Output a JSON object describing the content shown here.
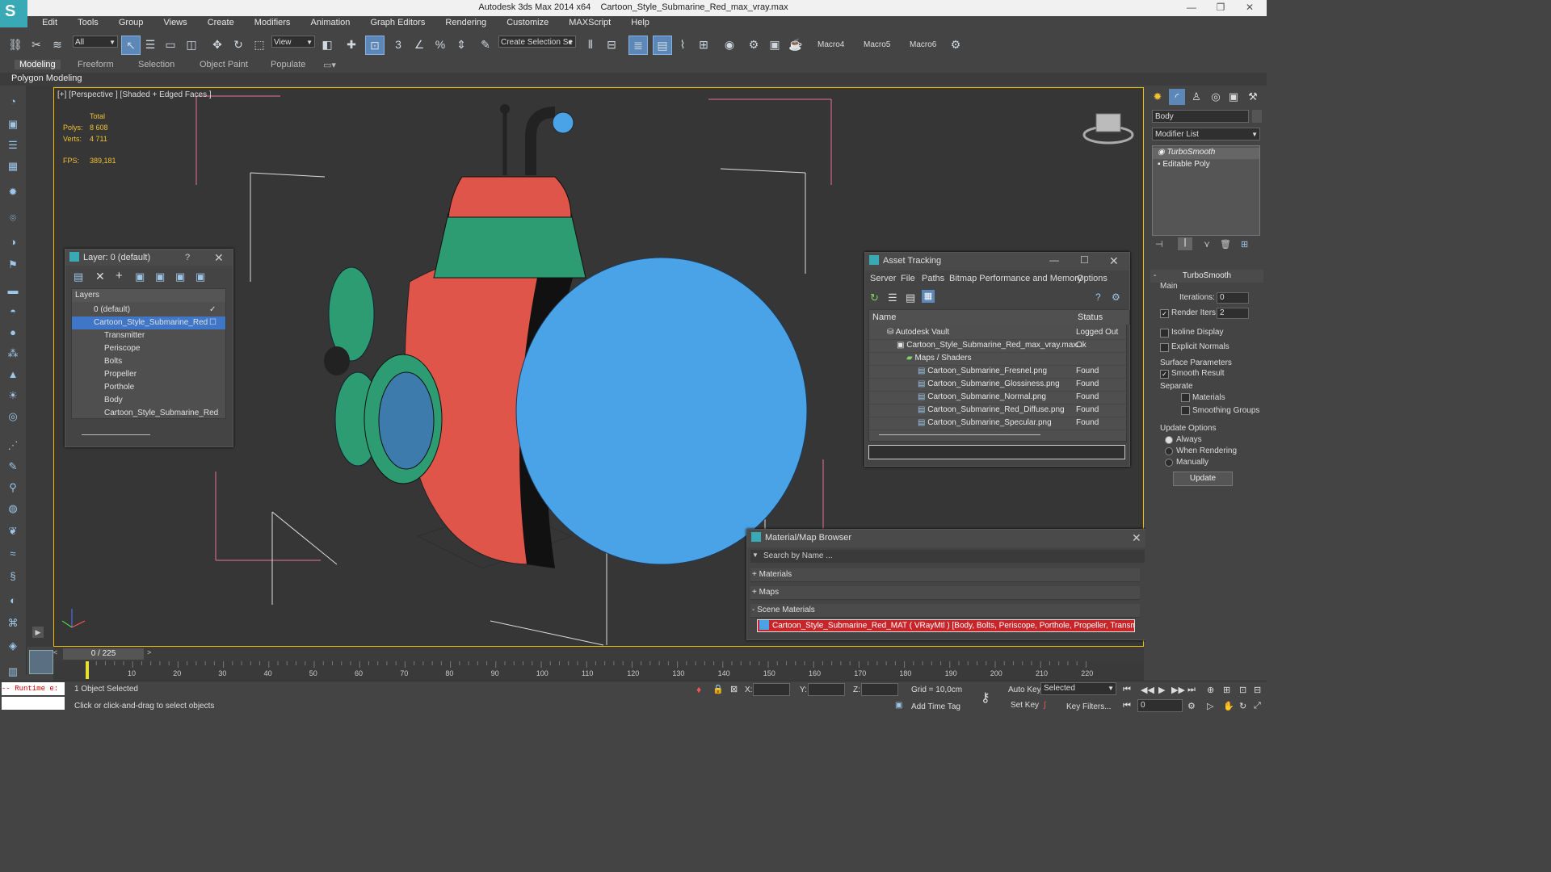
{
  "window": {
    "title_app": "Autodesk 3ds Max  2014 x64",
    "title_file": "Cartoon_Style_Submarine_Red_max_vray.max",
    "minimize": "—",
    "restore": "❐",
    "close": "✕"
  },
  "menu": [
    "Edit",
    "Tools",
    "Group",
    "Views",
    "Create",
    "Modifiers",
    "Animation",
    "Graph Editors",
    "Rendering",
    "Customize",
    "MAXScript",
    "Help"
  ],
  "toolbar": {
    "filter_value": "All",
    "ref_coord_value": "View",
    "selection_set_placeholder": "Create Selection Se",
    "macros": [
      "Macro4",
      "Macro5",
      "Macro6"
    ]
  },
  "ribbon": {
    "tabs": [
      "Modeling",
      "Freeform",
      "Selection",
      "Object Paint",
      "Populate"
    ],
    "sub_label": "Polygon Modeling"
  },
  "viewport": {
    "label": "[+] [Perspective ] [Shaded + Edged Faces ]",
    "stats_header": "Total",
    "polys_label": "Polys:",
    "polys_value": "8 608",
    "verts_label": "Verts:",
    "verts_value": "4 711",
    "fps_label": "FPS:",
    "fps_value": "389,181"
  },
  "layer_panel": {
    "title": "Layer: 0 (default)",
    "help": "?",
    "close": "✕",
    "column": "Layers",
    "rows": [
      {
        "label": "0 (default)",
        "indent": 0,
        "selected": false
      },
      {
        "label": "Cartoon_Style_Submarine_Red",
        "indent": 0,
        "selected": true
      },
      {
        "label": "Transmitter",
        "indent": 1,
        "selected": false
      },
      {
        "label": "Periscope",
        "indent": 1,
        "selected": false
      },
      {
        "label": "Bolts",
        "indent": 1,
        "selected": false
      },
      {
        "label": "Propeller",
        "indent": 1,
        "selected": false
      },
      {
        "label": "Porthole",
        "indent": 1,
        "selected": false
      },
      {
        "label": "Body",
        "indent": 1,
        "selected": false
      },
      {
        "label": "Cartoon_Style_Submarine_Red",
        "indent": 1,
        "selected": false
      }
    ]
  },
  "asset_panel": {
    "title": "Asset Tracking",
    "menu": [
      "Server",
      "File",
      "Paths",
      "Bitmap Performance and Memory",
      "Options"
    ],
    "col_name": "Name",
    "col_status": "Status",
    "rows": [
      {
        "name": "Autodesk Vault",
        "status": "Logged Out ..."
      },
      {
        "name": "Cartoon_Style_Submarine_Red_max_vray.max",
        "status": "Ok"
      },
      {
        "name": "Maps / Shaders",
        "status": ""
      },
      {
        "name": "Cartoon_Submarine_Fresnel.png",
        "status": "Found"
      },
      {
        "name": "Cartoon_Submarine_Glossiness.png",
        "status": "Found"
      },
      {
        "name": "Cartoon_Submarine_Normal.png",
        "status": "Found"
      },
      {
        "name": "Cartoon_Submarine_Red_Diffuse.png",
        "status": "Found"
      },
      {
        "name": "Cartoon_Submarine_Specular.png",
        "status": "Found"
      }
    ]
  },
  "material_browser": {
    "title": "Material/Map Browser",
    "search_placeholder": "Search by Name ...",
    "groups": [
      "+ Materials",
      "+ Maps",
      "- Scene Materials"
    ],
    "scene_material": "Cartoon_Style_Submarine_Red_MAT ( VRayMtl ) [Body, Bolts, Periscope, Porthole, Propeller, Transmitter]"
  },
  "command_panel": {
    "object_name": "Body",
    "modifier_list": "Modifier List",
    "stack": [
      "TurboSmooth",
      "Editable Poly"
    ],
    "rollout_title": "TurboSmooth",
    "main_group": "Main",
    "iterations_label": "Iterations:",
    "iterations_value": "0",
    "render_iters_label": "Render Iters:",
    "render_iters_value": "2",
    "isoline_label": "Isoline Display",
    "explicit_normals_label": "Explicit Normals",
    "surface_group": "Surface Parameters",
    "smooth_result_label": "Smooth Result",
    "separate_label": "Separate",
    "materials_label": "Materials",
    "smoothing_groups_label": "Smoothing Groups",
    "update_group": "Update Options",
    "always_label": "Always",
    "when_rendering_label": "When Rendering",
    "manually_label": "Manually",
    "update_button": "Update"
  },
  "timeline": {
    "frame_display": "0 / 225",
    "ticks": [
      "10",
      "20",
      "30",
      "40",
      "50",
      "60",
      "70",
      "80",
      "90",
      "100",
      "110",
      "120",
      "130",
      "140",
      "150",
      "160",
      "170",
      "180",
      "190",
      "200",
      "210",
      "220"
    ]
  },
  "status": {
    "runtime": "-- Runtime e:",
    "selected_text": "1 Object Selected",
    "prompt_text": "Click or click-and-drag to select objects",
    "x_label": "X:",
    "y_label": "Y:",
    "z_label": "Z:",
    "grid_text": "Grid = 10,0cm",
    "add_time_tag": "Add Time Tag",
    "auto_key": "Auto Key",
    "set_key": "Set Key",
    "selected_dropdown": "Selected",
    "key_filters": "Key Filters...",
    "frame_value": "0"
  },
  "colors": {
    "accent": "#38a9b5",
    "selection": "#3f76c8",
    "viewport_border": "#f0c000",
    "sub_red": "#e0554a",
    "sub_blue": "#4aa3e6",
    "sub_green": "#2e9c72"
  }
}
